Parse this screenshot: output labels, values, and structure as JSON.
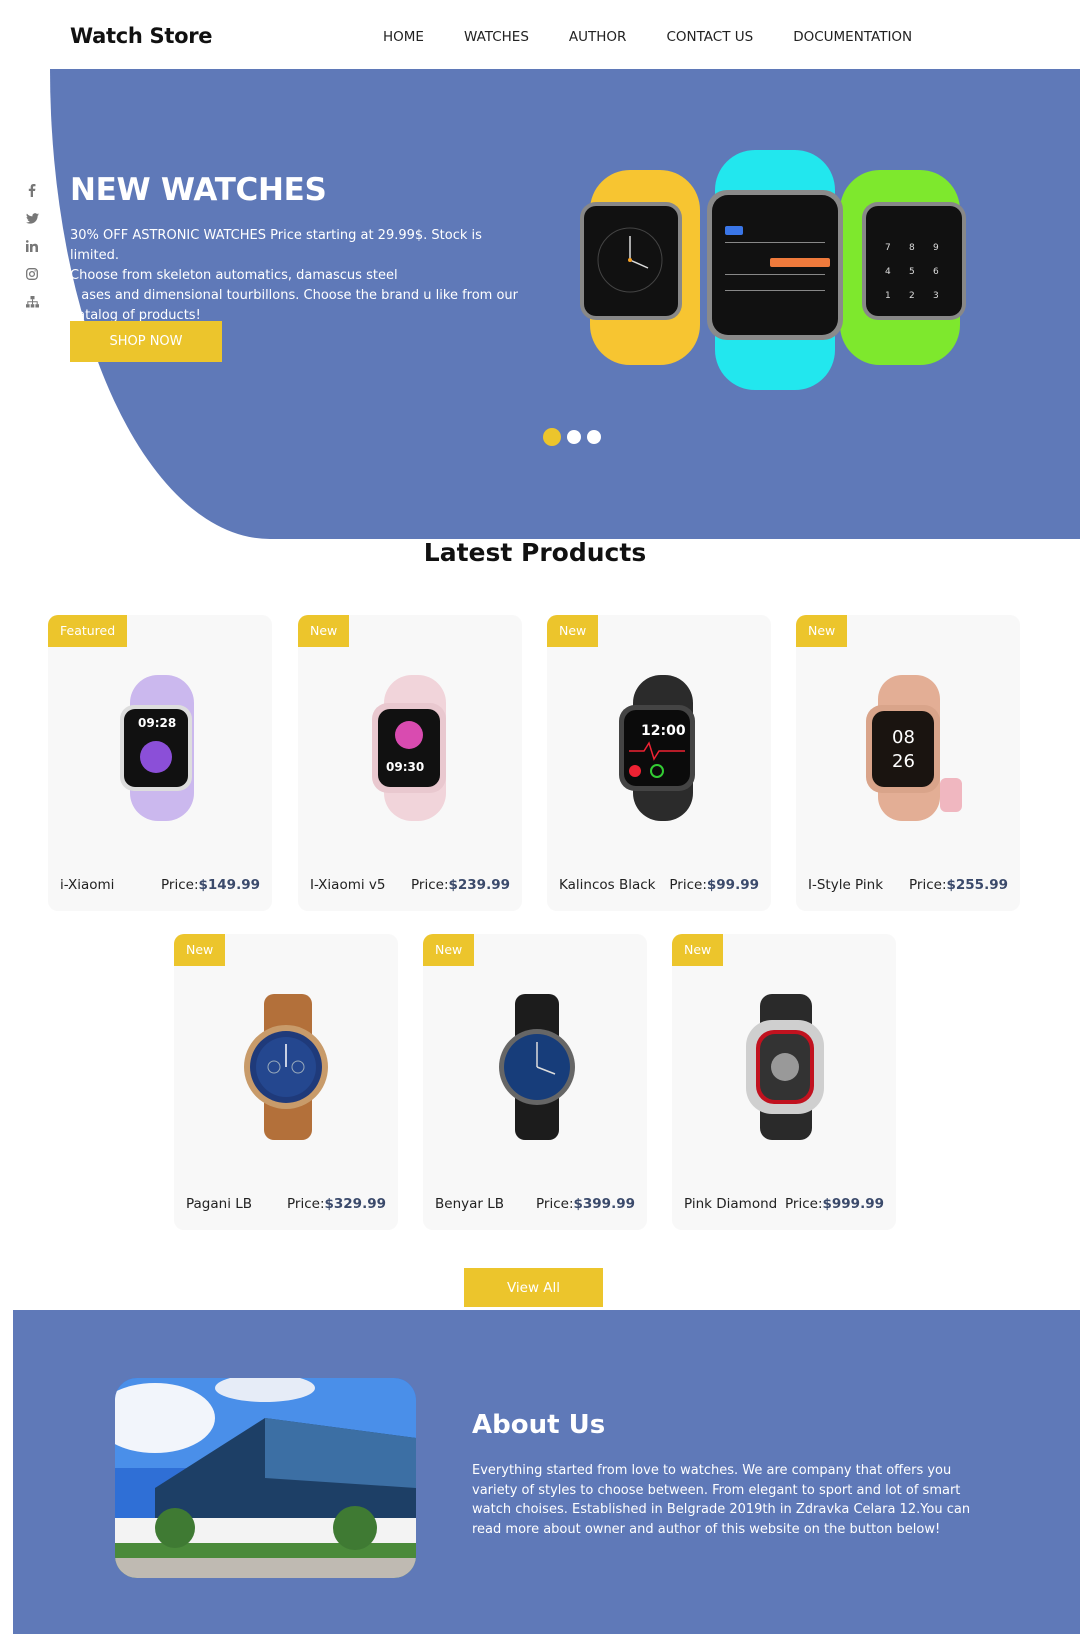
{
  "nav": {
    "brand": "Watch Store",
    "items": [
      "HOME",
      "WATCHES",
      "AUTHOR",
      "CONTACT US",
      "DOCUMENTATION"
    ]
  },
  "hero": {
    "title": "NEW WATCHES",
    "lines": [
      "30% OFF ASTRONIC WATCHES Price starting at 29.99$. Stock is limited.",
      "Choose from skeleton automatics, damascus steel",
      "c ases and dimensional tourbillons. Choose the brand u like from our",
      "catalog of products!"
    ],
    "button": "SHOP NOW",
    "slide_count": 3,
    "active_slide": 1
  },
  "social_icons": [
    "facebook-icon",
    "twitter-icon",
    "linkedin-icon",
    "instagram-icon",
    "sitemap-icon"
  ],
  "products": {
    "title": "Latest Products",
    "items": [
      {
        "badge": "Featured",
        "name": "i-Xiaomi",
        "price_label": "Price:",
        "price": "$149.99",
        "color": "#cbb8ee"
      },
      {
        "badge": "New",
        "name": "I-Xiaomi v5",
        "price_label": "Price:",
        "price": "$239.99",
        "color": "#f1d4da"
      },
      {
        "badge": "New",
        "name": "Kalincos Black",
        "price_label": "Price:",
        "price": "$99.99",
        "color": "#2b2b2b"
      },
      {
        "badge": "New",
        "name": "I-Style Pink",
        "price_label": "Price:",
        "price": "$255.99",
        "color": "#e3ae95"
      },
      {
        "badge": "New",
        "name": "Pagani LB",
        "price_label": "Price:",
        "price": "$329.99",
        "color": "#b3703a"
      },
      {
        "badge": "New",
        "name": "Benyar LB",
        "price_label": "Price:",
        "price": "$399.99",
        "color": "#1c1c1c"
      },
      {
        "badge": "New",
        "name": "Pink Diamond",
        "price_label": "Price:",
        "price": "$999.99",
        "color": "#2a2a2a"
      }
    ],
    "view_all": "View All"
  },
  "about": {
    "title": "About Us",
    "text": "Everything started from love to watches. We are company that offers you variety of styles to choose between. From elegant to sport and lot of smart watch choises. Established in Belgrade 2019th in Zdravka Celara 12.You can read more about owner and author of this website on the button below!"
  },
  "colors": {
    "primary": "#5f79b8",
    "accent": "#ecc52c",
    "card_bg": "#f8f8f8"
  }
}
